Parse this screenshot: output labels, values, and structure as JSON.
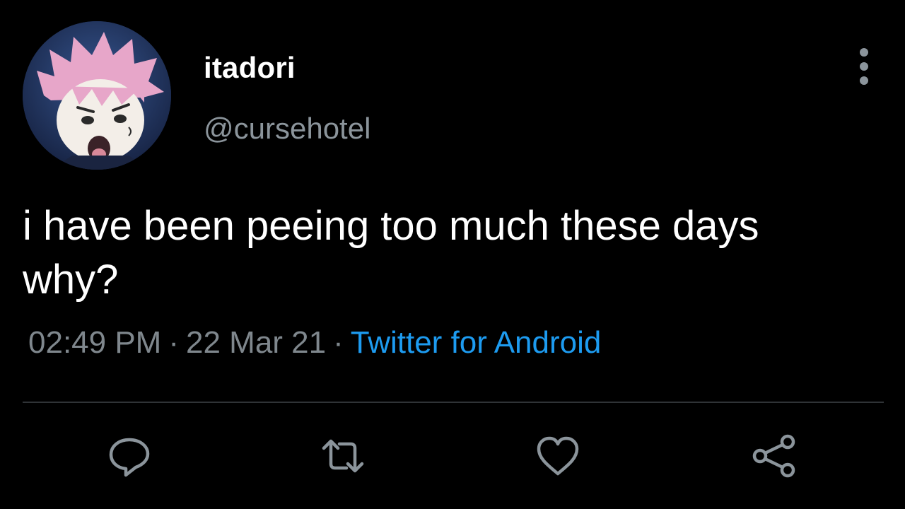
{
  "tweet": {
    "display_name": "itadori",
    "handle": "@cursehotel",
    "text_lines": [
      "i have been peeing too much these days",
      "why?"
    ],
    "time": "02:49 PM",
    "separator": "·",
    "date": "22 Mar 21",
    "source": "Twitter for Android",
    "avatar_icon": "anime-character-avatar"
  },
  "actions": {
    "reply_icon": "reply-icon",
    "retweet_icon": "retweet-icon",
    "like_icon": "like-icon",
    "share_icon": "share-icon",
    "more_icon": "more-vertical-icon"
  },
  "colors": {
    "background": "#000000",
    "text": "#ffffff",
    "muted": "#8b949b",
    "link": "#1d9bf0",
    "divider": "#2f3336"
  }
}
